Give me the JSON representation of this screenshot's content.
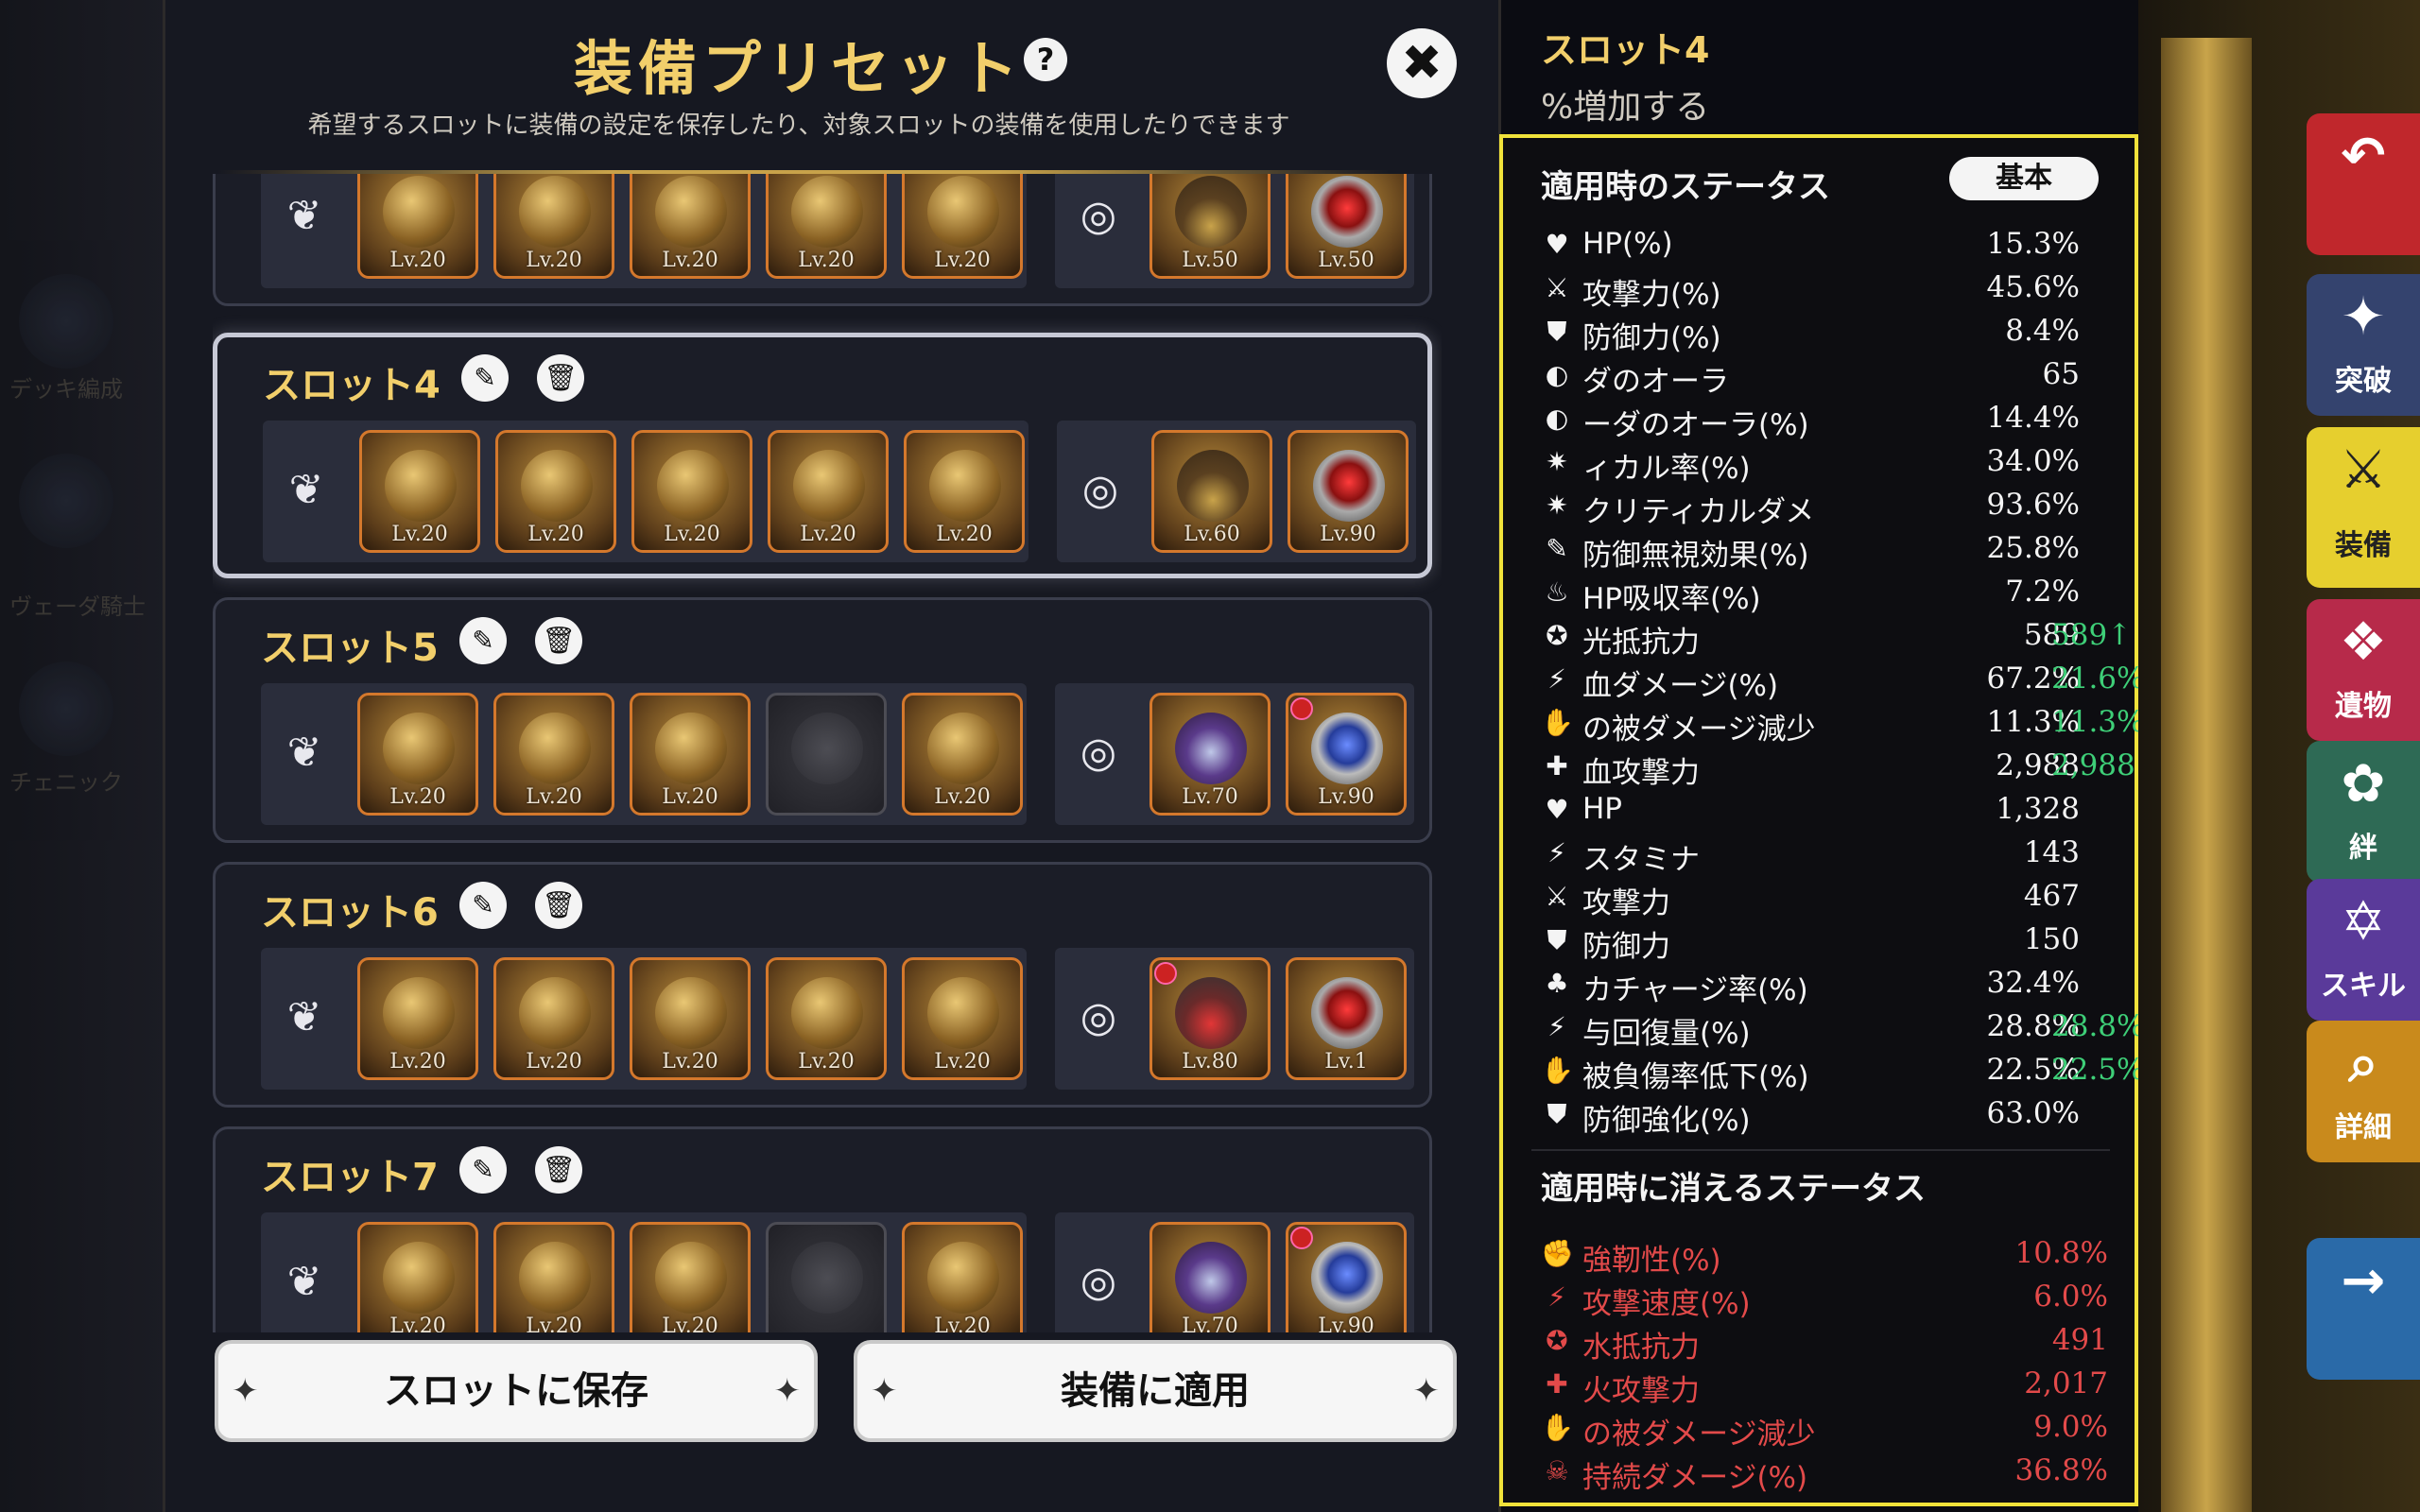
{
  "background": {
    "left_labels": [
      "デッキ編成",
      "ヴェーダ騎士",
      "チェニック"
    ]
  },
  "modal": {
    "title": "装備プリセット",
    "help": "?",
    "close": "✖",
    "description": "希望するスロットに装備の設定を保存したり、対象スロットの装備を使用したりできます",
    "save_button": "スロットに保存",
    "apply_button": "装備に適用",
    "btn_star": "✦"
  },
  "slots": [
    {
      "name": "",
      "items": [
        {
          "lv": "Lv.20"
        },
        {
          "lv": "Lv.20"
        },
        {
          "lv": "Lv.20"
        },
        {
          "lv": "Lv.20"
        },
        {
          "lv": "Lv.20"
        }
      ],
      "acc": [
        {
          "lv": "Lv.50"
        },
        {
          "lv": "Lv.50"
        }
      ]
    },
    {
      "name": "スロット4",
      "items": [
        {
          "lv": "Lv.20"
        },
        {
          "lv": "Lv.20"
        },
        {
          "lv": "Lv.20"
        },
        {
          "lv": "Lv.20"
        },
        {
          "lv": "Lv.20"
        }
      ],
      "acc": [
        {
          "lv": "Lv.60"
        },
        {
          "lv": "Lv.90"
        }
      ]
    },
    {
      "name": "スロット5",
      "items": [
        {
          "lv": "Lv.20"
        },
        {
          "lv": "Lv.20"
        },
        {
          "lv": "Lv.20"
        },
        {
          "lv": ""
        },
        {
          "lv": "Lv.20"
        }
      ],
      "acc": [
        {
          "lv": "Lv.70"
        },
        {
          "lv": "Lv.90"
        }
      ]
    },
    {
      "name": "スロット6",
      "items": [
        {
          "lv": "Lv.20"
        },
        {
          "lv": "Lv.20"
        },
        {
          "lv": "Lv.20"
        },
        {
          "lv": "Lv.20"
        },
        {
          "lv": "Lv.20"
        }
      ],
      "acc": [
        {
          "lv": "Lv.80"
        },
        {
          "lv": "Lv.1"
        }
      ]
    },
    {
      "name": "スロット7",
      "items": [
        {
          "lv": "Lv.20"
        },
        {
          "lv": "Lv.20"
        },
        {
          "lv": "Lv.20"
        },
        {
          "lv": ""
        },
        {
          "lv": "Lv.20"
        }
      ],
      "acc": [
        {
          "lv": "Lv.70"
        },
        {
          "lv": "Lv.90"
        }
      ]
    }
  ],
  "header_right": {
    "slot": "スロット4",
    "line2": "%増加する"
  },
  "stats_panel": {
    "apply_title": "適用時のステータス",
    "base_button": "基本",
    "remove_title": "適用時に消えるステータス",
    "apply_stats": [
      {
        "icon": "♥",
        "name": "HP(%)",
        "value": "15.3%",
        "diff": ""
      },
      {
        "icon": "⚔",
        "name": "攻撃力(%)",
        "value": "45.6%",
        "diff": ""
      },
      {
        "icon": "⛊",
        "name": "防御力(%)",
        "value": "8.4%",
        "diff": ""
      },
      {
        "icon": "◐",
        "name": "ダのオーラ",
        "value": "65",
        "diff": ""
      },
      {
        "icon": "◐",
        "name": "ーダのオーラ(%)",
        "value": "14.4%",
        "diff": ""
      },
      {
        "icon": "✷",
        "name": "ィカル率(%)",
        "value": "34.0%",
        "diff": ""
      },
      {
        "icon": "✷",
        "name": "クリティカルダメ",
        "value": "93.6%",
        "diff": ""
      },
      {
        "icon": "✎",
        "name": "防御無視効果(%)",
        "value": "25.8%",
        "diff": ""
      },
      {
        "icon": "♨",
        "name": "HP吸収率(%)",
        "value": "7.2%",
        "diff": ""
      },
      {
        "icon": "✪",
        "name": "光抵抗力",
        "value": "589",
        "diff": "589↑"
      },
      {
        "icon": "⚡",
        "name": "血ダメージ(%)",
        "value": "67.2%",
        "diff": "21.6%↑"
      },
      {
        "icon": "✋",
        "name": "の被ダメージ減少",
        "value": "11.3%",
        "diff": "11.3%↑"
      },
      {
        "icon": "✚",
        "name": "血攻撃力",
        "value": "2,988",
        "diff": "2,988↑"
      },
      {
        "icon": "♥",
        "name": "HP",
        "value": "1,328",
        "diff": ""
      },
      {
        "icon": "⚡",
        "name": "スタミナ",
        "value": "143",
        "diff": ""
      },
      {
        "icon": "⚔",
        "name": "攻撃力",
        "value": "467",
        "diff": ""
      },
      {
        "icon": "⛊",
        "name": "防御力",
        "value": "150",
        "diff": ""
      },
      {
        "icon": "♣",
        "name": "カチャージ率(%)",
        "value": "32.4%",
        "diff": ""
      },
      {
        "icon": "⚡",
        "name": "与回復量(%)",
        "value": "28.8%",
        "diff": "28.8%↑"
      },
      {
        "icon": "✋",
        "name": "被負傷率低下(%)",
        "value": "22.5%",
        "diff": "22.5%↑"
      },
      {
        "icon": "⛊",
        "name": "防御強化(%)",
        "value": "63.0%",
        "diff": ""
      }
    ],
    "remove_stats": [
      {
        "icon": "✊",
        "name": "強靭性(%)",
        "value": "10.8%"
      },
      {
        "icon": "⚡",
        "name": "攻撃速度(%)",
        "value": "6.0%"
      },
      {
        "icon": "✪",
        "name": "水抵抗力",
        "value": "491"
      },
      {
        "icon": "✚",
        "name": "火攻撃力",
        "value": "2,017"
      },
      {
        "icon": "✋",
        "name": "の被ダメージ減少",
        "value": "9.0%"
      },
      {
        "icon": "☠",
        "name": "持続ダメージ(%)",
        "value": "36.8%"
      }
    ]
  },
  "side_menu": [
    {
      "id": "back",
      "label": "",
      "icon": "↶"
    },
    {
      "id": "break",
      "label": "突破",
      "icon": "✦"
    },
    {
      "id": "equip",
      "label": "装備",
      "icon": "⚔"
    },
    {
      "id": "relic",
      "label": "遺物",
      "icon": "❖"
    },
    {
      "id": "bond",
      "label": "絆",
      "icon": "✿"
    },
    {
      "id": "skill",
      "label": "スキル",
      "icon": "✡"
    },
    {
      "id": "detail",
      "label": "詳細",
      "icon": "⌕"
    },
    {
      "id": "next",
      "label": "",
      "icon": "→"
    }
  ],
  "colors": {
    "accent_gold": "#f2cf6b",
    "highlight_yellow": "#f0e23a",
    "increase_green": "#3ecf78",
    "decrease_red": "#e34a4a"
  }
}
